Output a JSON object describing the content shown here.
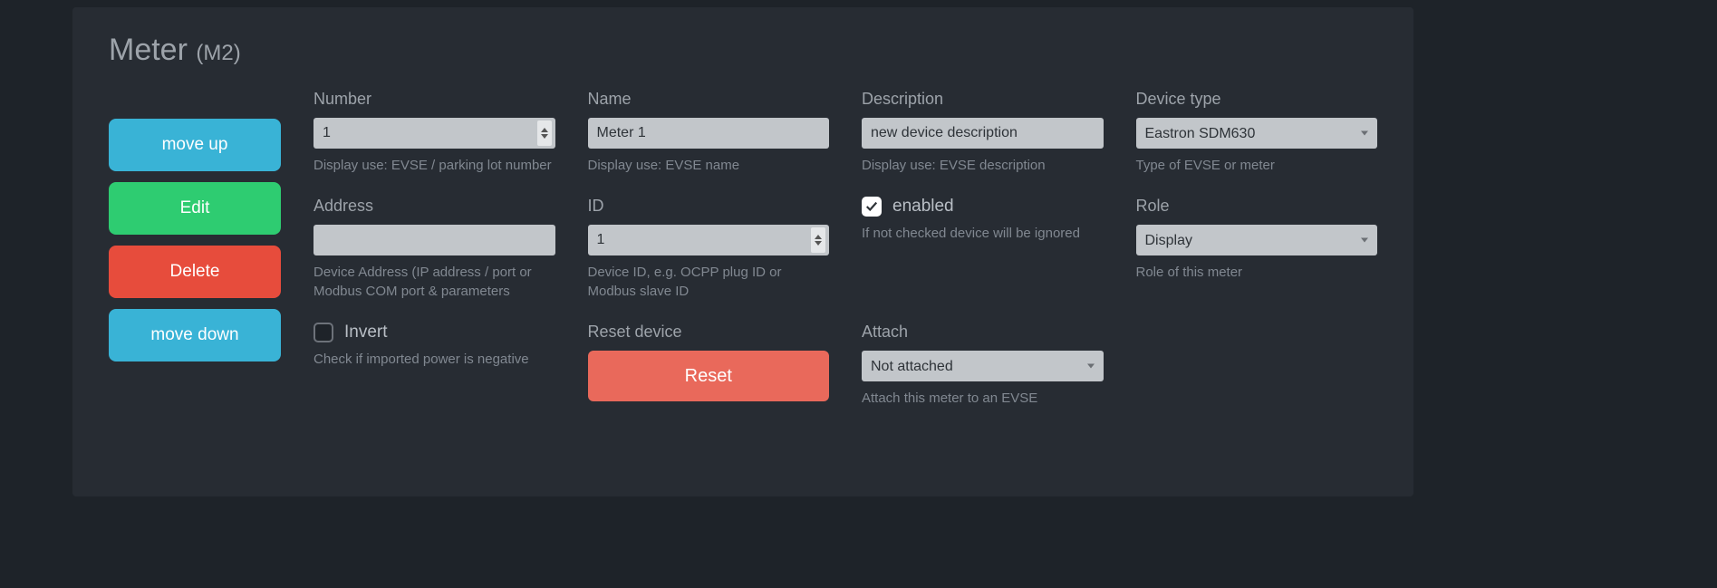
{
  "title": {
    "main": "Meter",
    "sub": "(M2)"
  },
  "sidebar": {
    "move_up": "move up",
    "edit": "Edit",
    "delete": "Delete",
    "move_down": "move down"
  },
  "fields": {
    "number": {
      "label": "Number",
      "value": "1",
      "help": "Display use: EVSE / parking lot number"
    },
    "name": {
      "label": "Name",
      "value": "Meter 1",
      "help": "Display use: EVSE name"
    },
    "description": {
      "label": "Description",
      "value": "new device description",
      "help": "Display use: EVSE description"
    },
    "device_type": {
      "label": "Device type",
      "value": "Eastron SDM630",
      "help": "Type of EVSE or meter"
    },
    "address": {
      "label": "Address",
      "value": "",
      "help": "Device Address (IP address / port or Modbus COM port & parameters"
    },
    "id": {
      "label": "ID",
      "value": "1",
      "help": "Device ID, e.g. OCPP plug ID or Modbus slave ID"
    },
    "enabled": {
      "label": "enabled",
      "checked": true,
      "help": "If not checked device will be ignored"
    },
    "role": {
      "label": "Role",
      "value": "Display",
      "help": "Role of this meter"
    },
    "invert": {
      "label": "Invert",
      "checked": false,
      "help": "Check if imported power is negative"
    },
    "reset": {
      "label": "Reset device",
      "button": "Reset"
    },
    "attach": {
      "label": "Attach",
      "value": "Not attached",
      "help": "Attach this meter to an EVSE"
    }
  }
}
